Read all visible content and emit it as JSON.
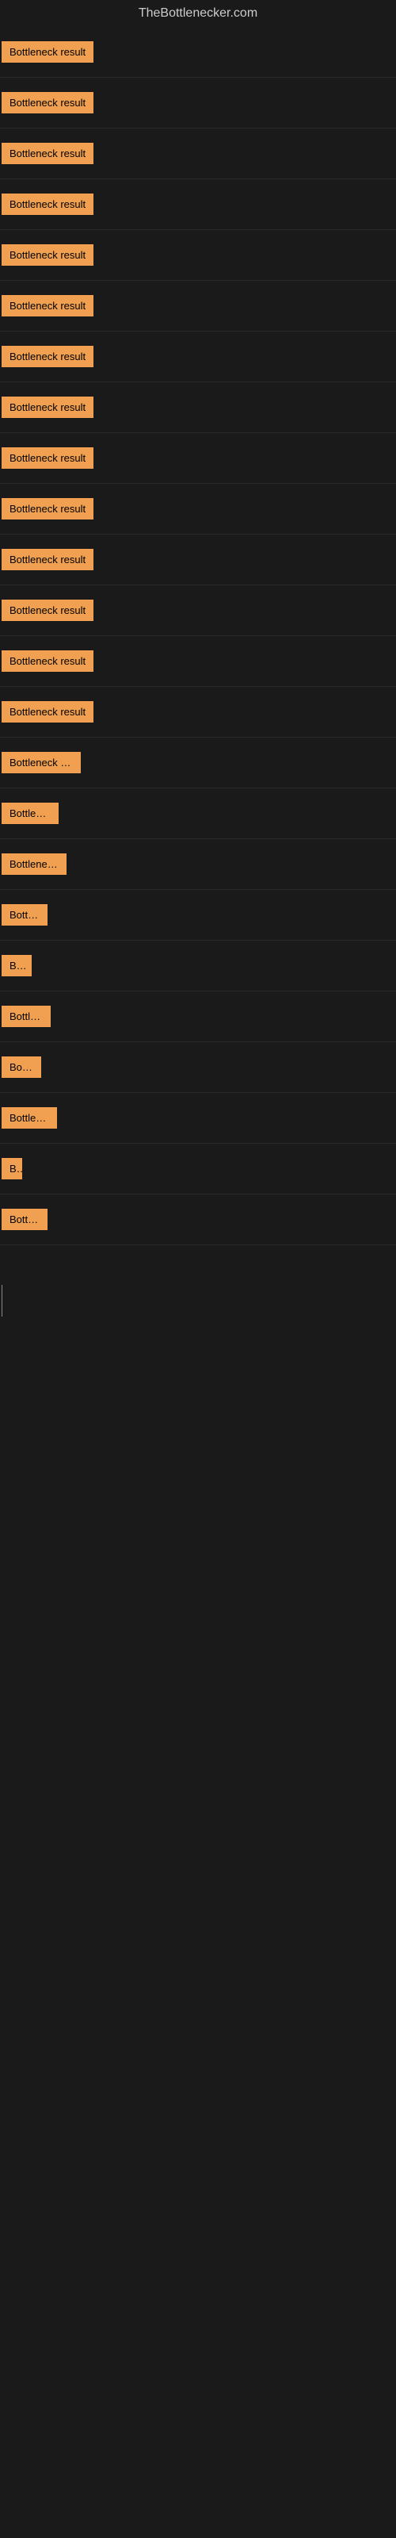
{
  "site": {
    "title": "TheBottlenecker.com"
  },
  "buttons": [
    {
      "label": "Bottleneck result",
      "width": 120
    },
    {
      "label": "Bottleneck result",
      "width": 120
    },
    {
      "label": "Bottleneck result",
      "width": 120
    },
    {
      "label": "Bottleneck result",
      "width": 120
    },
    {
      "label": "Bottleneck result",
      "width": 120
    },
    {
      "label": "Bottleneck result",
      "width": 120
    },
    {
      "label": "Bottleneck result",
      "width": 120
    },
    {
      "label": "Bottleneck result",
      "width": 120
    },
    {
      "label": "Bottleneck result",
      "width": 120
    },
    {
      "label": "Bottleneck result",
      "width": 120
    },
    {
      "label": "Bottleneck result",
      "width": 120
    },
    {
      "label": "Bottleneck result",
      "width": 120
    },
    {
      "label": "Bottleneck result",
      "width": 120
    },
    {
      "label": "Bottleneck result",
      "width": 120
    },
    {
      "label": "Bottleneck res",
      "width": 100
    },
    {
      "label": "Bottlenec",
      "width": 72
    },
    {
      "label": "Bottleneck r",
      "width": 82
    },
    {
      "label": "Bottlen",
      "width": 58
    },
    {
      "label": "Bott",
      "width": 38
    },
    {
      "label": "Bottlens",
      "width": 62
    },
    {
      "label": "Bottle",
      "width": 50
    },
    {
      "label": "Bottlenec",
      "width": 70
    },
    {
      "label": "Bo",
      "width": 26
    },
    {
      "label": "Bottlen",
      "width": 58
    }
  ],
  "colors": {
    "button_bg": "#f0a050",
    "body_bg": "#1a1a1a",
    "title_color": "#cccccc"
  }
}
